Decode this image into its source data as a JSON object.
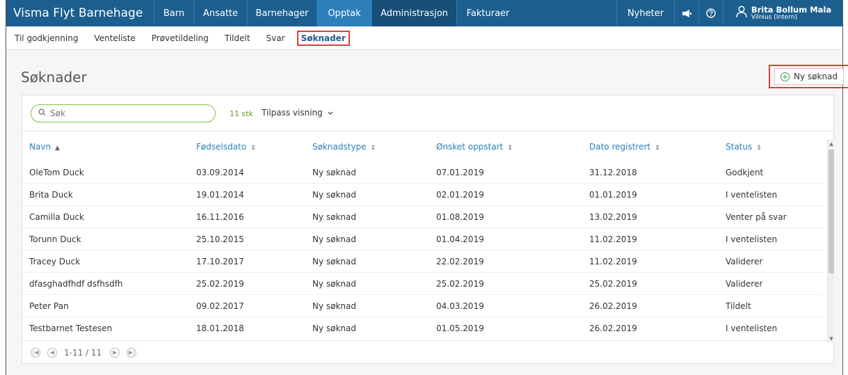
{
  "app": {
    "brand": "Visma Flyt Barnehage",
    "nav": [
      {
        "label": "Barn"
      },
      {
        "label": "Ansatte"
      },
      {
        "label": "Barnehager"
      },
      {
        "label": "Opptak"
      },
      {
        "label": "Administrasjon"
      },
      {
        "label": "Fakturaer"
      }
    ],
    "news_label": "Nyheter",
    "user": {
      "name": "Brita Bollum Mala",
      "org": "Vilnius (Intern)"
    }
  },
  "subnav": [
    {
      "label": "Til godkjenning"
    },
    {
      "label": "Venteliste"
    },
    {
      "label": "Prøvetildeling"
    },
    {
      "label": "Tildelt"
    },
    {
      "label": "Svar"
    },
    {
      "label": "Søknader"
    }
  ],
  "page": {
    "title": "Søknader",
    "new_button": "Ny søknad"
  },
  "toolbar": {
    "search_placeholder": "Søk",
    "count": "11 stk",
    "customize": "Tilpass visning"
  },
  "table": {
    "columns": [
      "Navn",
      "Fødselsdato",
      "Søknadstype",
      "Ønsket oppstart",
      "Dato registrert",
      "Status"
    ],
    "rows": [
      [
        "OleTom Duck",
        "03.09.2014",
        "Ny søknad",
        "07.01.2019",
        "31.12.2018",
        "Godkjent"
      ],
      [
        "Brita Duck",
        "19.01.2014",
        "Ny søknad",
        "02.01.2019",
        "01.01.2019",
        "I ventelisten"
      ],
      [
        "Camilla Duck",
        "16.11.2016",
        "Ny søknad",
        "01.08.2019",
        "13.02.2019",
        "Venter på svar"
      ],
      [
        "Torunn Duck",
        "25.10.2015",
        "Ny søknad",
        "01.04.2019",
        "11.02.2019",
        "I ventelisten"
      ],
      [
        "Tracey Duck",
        "17.10.2017",
        "Ny søknad",
        "22.02.2019",
        "11.02.2019",
        "Validerer"
      ],
      [
        "dfasghadfhdf dsfhsdfh",
        "25.02.2019",
        "Ny søknad",
        "25.02.2019",
        "25.02.2019",
        "Validerer"
      ],
      [
        "Peter Pan",
        "09.02.2017",
        "Ny søknad",
        "04.03.2019",
        "26.02.2019",
        "Tildelt"
      ],
      [
        "Testbarnet Testesen",
        "18.01.2018",
        "Ny søknad",
        "01.05.2019",
        "26.02.2019",
        "I ventelisten"
      ]
    ]
  },
  "pager": {
    "range": "1-11 / 11"
  },
  "icons": {
    "search": "search-icon",
    "news": "megaphone-icon",
    "help": "help-icon",
    "user": "user-icon",
    "add": "plus-circle-icon"
  },
  "colors": {
    "topbar": "#1c5f8f",
    "active_nav": "#2c7fb8",
    "highlight": "#e03c3c",
    "link": "#2c7fb8",
    "accent_green": "#6a9b2d"
  }
}
